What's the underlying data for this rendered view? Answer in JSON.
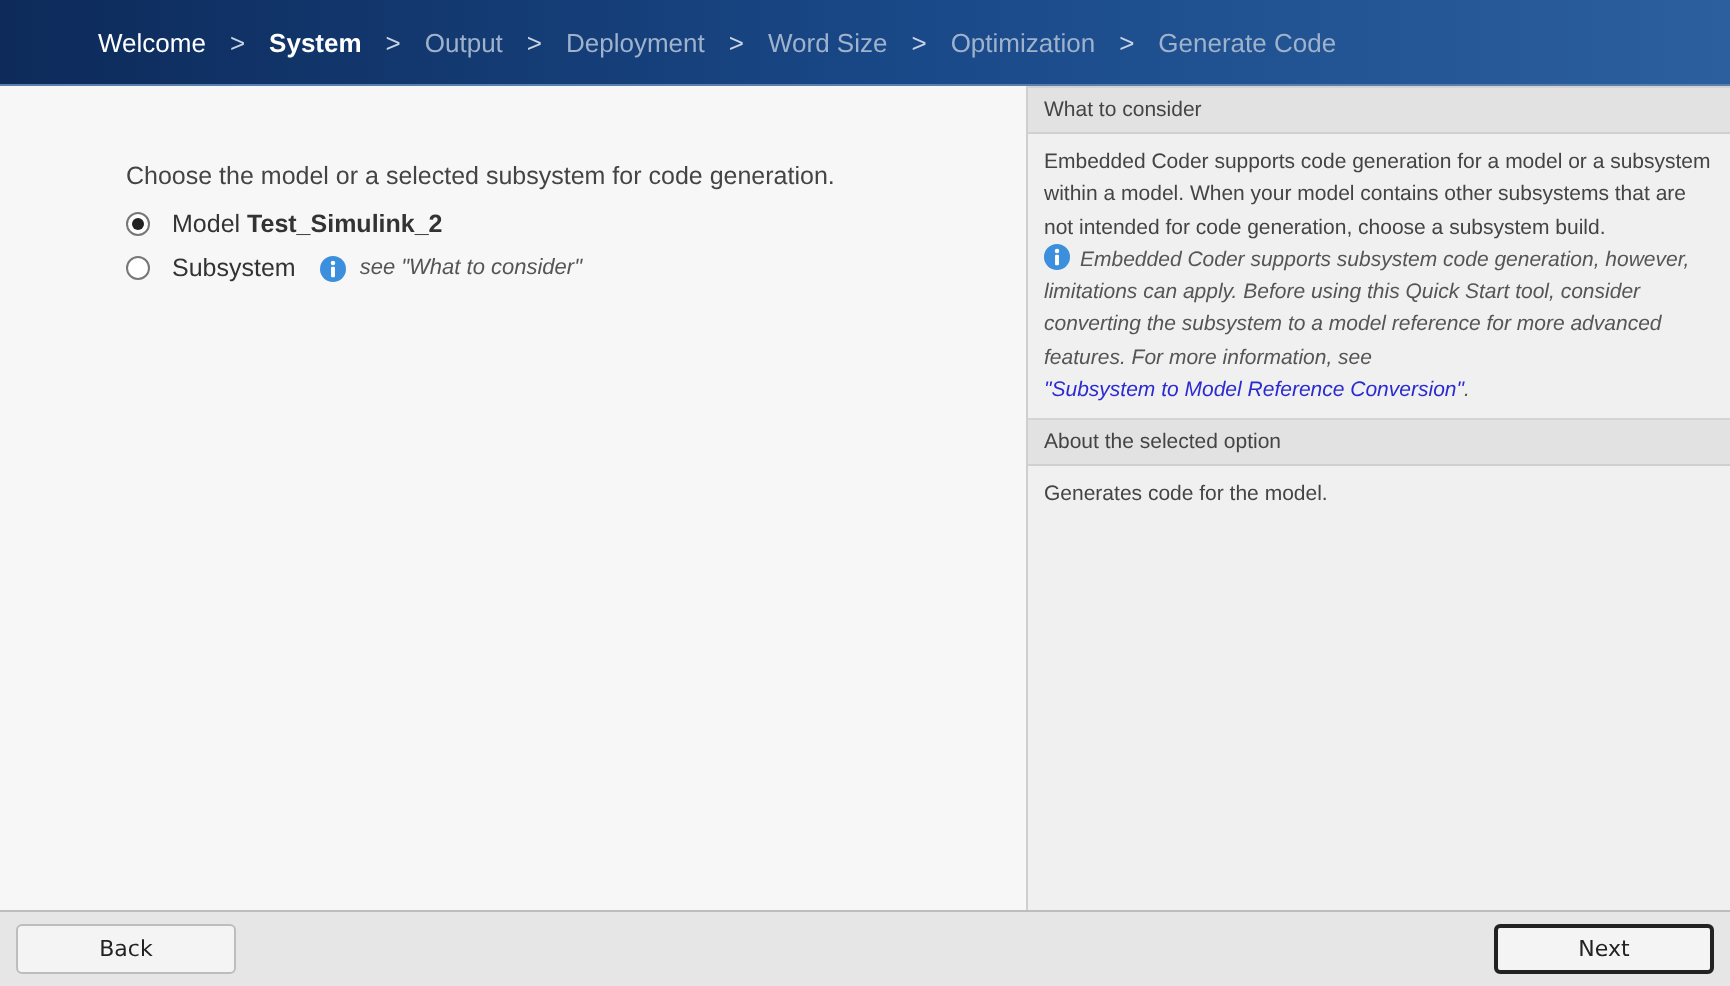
{
  "steps": [
    {
      "label": "Welcome",
      "completed": true,
      "selected": false
    },
    {
      "separator": ">",
      "label": "System",
      "completed": false,
      "selected": true
    },
    {
      "separator": ">",
      "label": "Output",
      "completed": false,
      "selected": false
    },
    {
      "separator": ">",
      "label": "Deployment",
      "completed": false,
      "selected": false
    },
    {
      "separator": ">",
      "label": "Word Size",
      "completed": false,
      "selected": false
    },
    {
      "separator": ">",
      "label": "Optimization",
      "completed": false,
      "selected": false
    },
    {
      "separator": ">",
      "label": "Generate Code",
      "completed": false,
      "selected": false
    }
  ],
  "main": {
    "prompt": "Choose the model or a selected subsystem for code generation.",
    "options": [
      {
        "label": "Model **Test_Simulink_2**",
        "selected": true
      },
      {
        "label": "Subsystem",
        "selected": false,
        "hint": "see \"What to consider\""
      }
    ]
  },
  "side": {
    "sections": [
      {
        "title": "What to consider",
        "text": "Embedded Coder supports code generation for a model or a subsystem within a model. When your model contains other subsystems that are not intended for code generation, choose a subsystem build.",
        "note": {
          "text": "Embedded Coder supports subsystem code generation, however, limitations can apply. Before using this Quick Start tool, consider converting the subsystem to a model reference for more advanced features. For more information, see ",
          "link": "\"Subsystem to Model Reference Conversion\"",
          "tail": "."
        }
      },
      {
        "title": "About the selected option",
        "text": "Generates code for the model."
      }
    ]
  },
  "buttons": [
    {
      "label": "Back",
      "default": false
    },
    {
      "label": "Next",
      "default": true
    }
  ]
}
